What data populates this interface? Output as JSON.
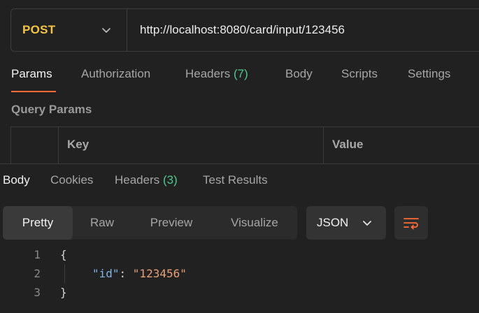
{
  "request": {
    "method": "POST",
    "url": "http://localhost:8080/card/input/123456"
  },
  "request_tabs": [
    {
      "label": "Params",
      "active": true
    },
    {
      "label": "Authorization"
    },
    {
      "label": "Headers",
      "count": "(7)"
    },
    {
      "label": "Body"
    },
    {
      "label": "Scripts"
    },
    {
      "label": "Settings"
    }
  ],
  "query_params": {
    "title": "Query Params",
    "columns": [
      "Key",
      "Value"
    ]
  },
  "response_tabs": [
    {
      "label": "Body",
      "active": true
    },
    {
      "label": "Cookies"
    },
    {
      "label": "Headers",
      "count": "(3)"
    },
    {
      "label": "Test Results"
    }
  ],
  "view_modes": [
    {
      "label": "Pretty",
      "active": true
    },
    {
      "label": "Raw"
    },
    {
      "label": "Preview"
    },
    {
      "label": "Visualize"
    }
  ],
  "format": {
    "selected": "JSON"
  },
  "icons": {
    "method_dropdown": "chevron-down-icon",
    "format_dropdown": "chevron-down-icon",
    "wrap": "wrap-lines-icon"
  },
  "colors": {
    "accent": "#ff6c37",
    "method": "#f5c542",
    "count": "#4ec98d",
    "json_key": "#7fb4e8",
    "json_string": "#e99f76"
  },
  "response_body": {
    "lines": [
      {
        "number": "1",
        "open": "{"
      },
      {
        "number": "2",
        "key": "\"id\"",
        "sep": ": ",
        "value": "\"123456\""
      },
      {
        "number": "3",
        "close": "}"
      }
    ]
  }
}
